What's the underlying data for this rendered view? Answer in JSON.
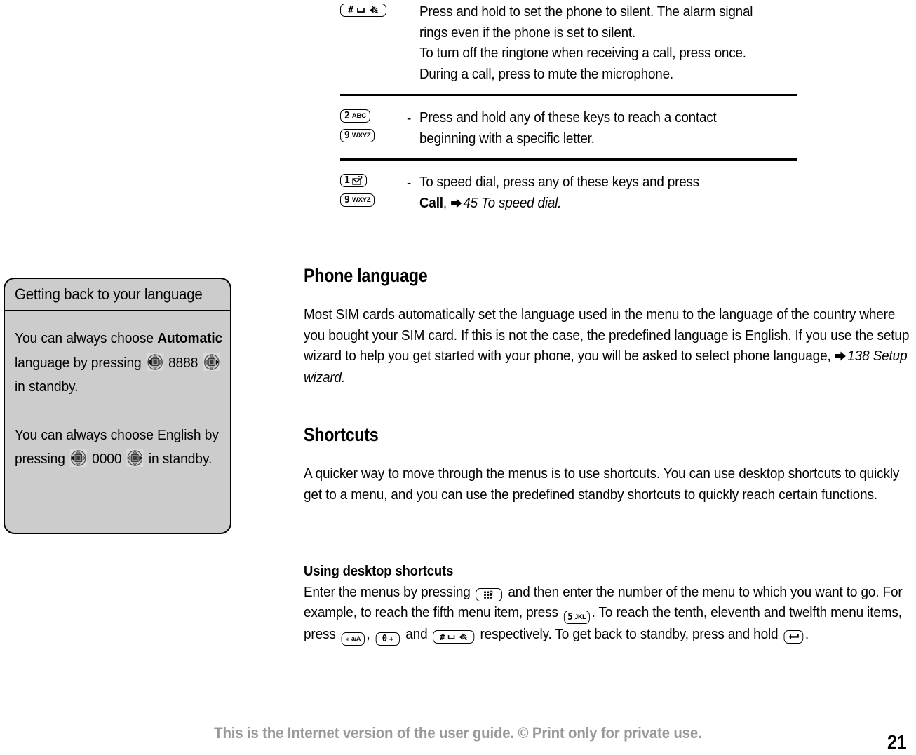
{
  "page": {
    "number": "21",
    "footer_note": "This is the Internet version of the user guide. © Print only for private use."
  },
  "key_table": {
    "rows": [
      {
        "keys": [
          {
            "icon": "hash-space-silent-key",
            "num": "#",
            "sub": ""
          }
        ],
        "dash": "",
        "lines": [
          "Press and hold to set the phone to silent. The alarm signal rings even if the phone is set to silent.",
          "To turn off the ringtone when receiving a call, press once.",
          "During a call, press to mute the microphone."
        ]
      },
      {
        "keys": [
          {
            "icon": "key-2-abc",
            "num": "2",
            "sub": "ABC"
          },
          {
            "icon": "key-9-wxyz",
            "num": "9",
            "sub": "WXYZ"
          }
        ],
        "dash": "-",
        "lines": [
          "Press and hold any of these keys to reach a contact beginning with a specific letter."
        ]
      },
      {
        "keys": [
          {
            "icon": "key-1-voicemail",
            "num": "1",
            "sub": ""
          },
          {
            "icon": "key-9-wxyz",
            "num": "9",
            "sub": "WXYZ"
          }
        ],
        "dash": "-",
        "lines": [
          "To speed dial, press any of these keys and press"
        ],
        "bold_word": "Call",
        "after_bold": ",",
        "reference": "45 To speed dial."
      }
    ]
  },
  "sections": {
    "phone_language": {
      "heading": "Phone language",
      "body_before_ref": "Most SIM cards automatically set the language used in the menu to the language of the country where you bought your SIM card. If this is not the case, the predefined language is English. If you use the setup wizard to help you get started with your phone, you will be asked to select phone language,",
      "reference": "138 Setup wizard."
    },
    "shortcuts": {
      "heading": "Shortcuts",
      "body": "A quicker way to move through the menus is to use shortcuts. You can use desktop shortcuts to quickly get to a menu, and you can use the predefined standby shortcuts to quickly reach certain functions."
    },
    "desktop_shortcuts": {
      "subheading": "Using desktop shortcuts",
      "t1": "Enter the menus by pressing",
      "t2": "and then enter the number of the menu to which you want to go. For example, to reach the fifth menu item, press",
      "t3": ". To reach the tenth, eleventh and twelfth menu items, press",
      "t4": ",",
      "t5": "and",
      "t6": "respectively. To get back to standby, press and hold",
      "t7": ".",
      "keys": {
        "menu": {
          "icon": "menu-grid-key",
          "label": ""
        },
        "five": {
          "icon": "key-5-jkl",
          "num": "5",
          "sub": "JKL"
        },
        "star": {
          "icon": "key-star-case",
          "num": "✳",
          "sub": "a/A"
        },
        "zero": {
          "icon": "key-0-plus",
          "num": "0",
          "sub": "+"
        },
        "hash": {
          "icon": "key-hash-silent",
          "num": "#",
          "sub": ""
        },
        "back": {
          "icon": "back-key",
          "label": ""
        }
      }
    }
  },
  "tip_box": {
    "title": "Getting back to your language",
    "p1_a": "You can always choose",
    "p1_bold": "Automatic",
    "p1_b": "language by pressing",
    "p1_code": "8888",
    "p1_c": "in standby.",
    "p2_a": "You can always choose English by pressing",
    "p2_code": "0000",
    "p2_b": "in standby.",
    "nav_left_icon": "nav-key-left-icon",
    "nav_right_icon": "nav-key-right-icon"
  },
  "colors": {
    "tip_box_bg": "#cccccc",
    "footer_text": "#999999",
    "ink": "#000000"
  }
}
